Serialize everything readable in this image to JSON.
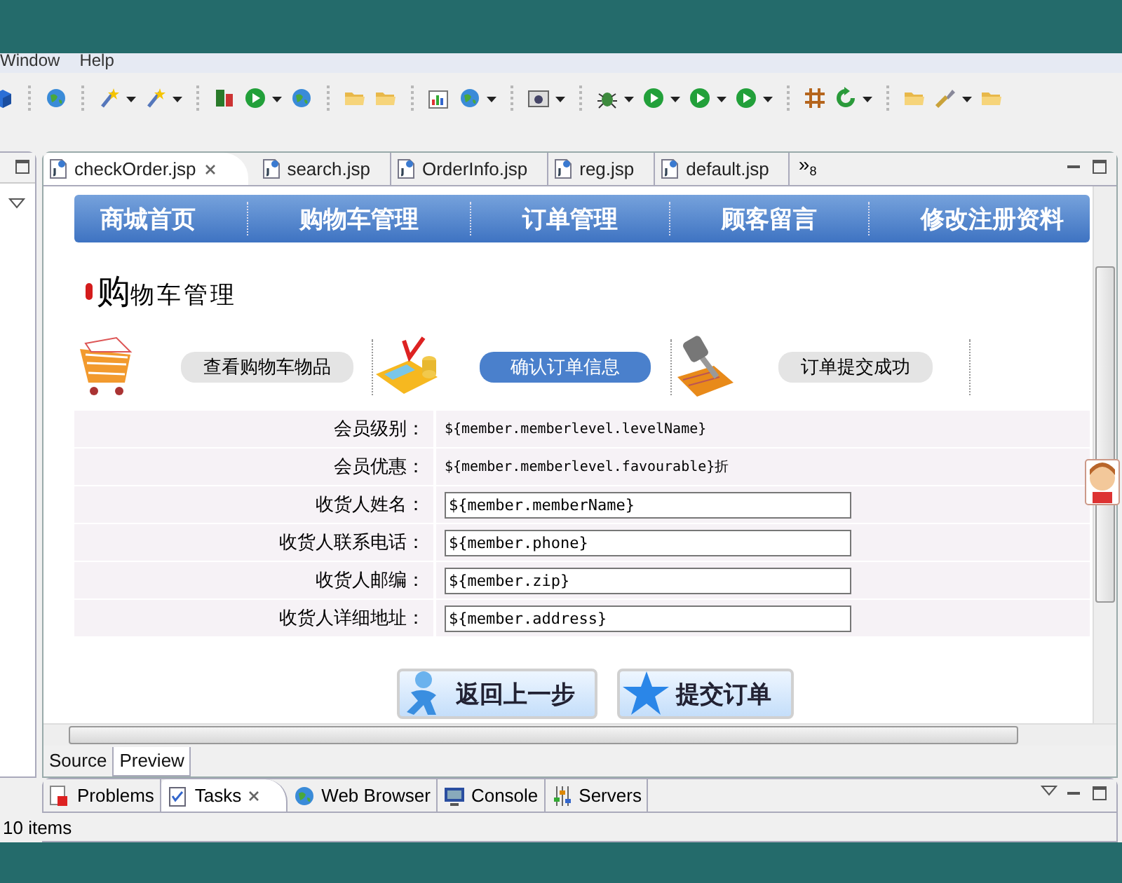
{
  "menu": [
    "Window",
    "Help"
  ],
  "editor_tabs": [
    {
      "label": "checkOrder.jsp",
      "selected": true
    },
    {
      "label": "search.jsp",
      "selected": false
    },
    {
      "label": "OrderInfo.jsp",
      "selected": false
    },
    {
      "label": "reg.jsp",
      "selected": false
    },
    {
      "label": "default.jsp",
      "selected": false
    }
  ],
  "overflow": {
    "label": "»",
    "count": "8"
  },
  "nav": [
    "商城首页",
    "购物车管理",
    "订单管理",
    "顾客留言",
    "修改注册资料"
  ],
  "heading": {
    "lead": "购",
    "rest": "物车管理"
  },
  "steps": [
    {
      "label": "查看购物车物品",
      "selected": false
    },
    {
      "label": "确认订单信息",
      "selected": true
    },
    {
      "label": "订单提交成功",
      "selected": false
    }
  ],
  "form": [
    {
      "label": "会员级别：",
      "value": "${member.memberlevel.levelName}",
      "kind": "text"
    },
    {
      "label": "会员优惠：",
      "value": "${member.memberlevel.favourable}折",
      "kind": "text"
    },
    {
      "label": "收货人姓名：",
      "value": "${member.memberName}",
      "kind": "input"
    },
    {
      "label": "收货人联系电话：",
      "value": "${member.phone}",
      "kind": "input"
    },
    {
      "label": "收货人邮编：",
      "value": "${member.zip}",
      "kind": "input"
    },
    {
      "label": "收货人详细地址：",
      "value": "${member.address}",
      "kind": "input"
    }
  ],
  "buttons": [
    "返回上一步",
    "提交订单"
  ],
  "view_tabs": [
    {
      "label": "Source",
      "selected": false
    },
    {
      "label": "Preview",
      "selected": true
    }
  ],
  "panel_tabs": [
    {
      "label": "Problems",
      "selected": false
    },
    {
      "label": "Tasks",
      "selected": true
    },
    {
      "label": "Web Browser",
      "selected": false
    },
    {
      "label": "Console",
      "selected": false
    },
    {
      "label": "Servers",
      "selected": false
    }
  ],
  "status": "10 items"
}
